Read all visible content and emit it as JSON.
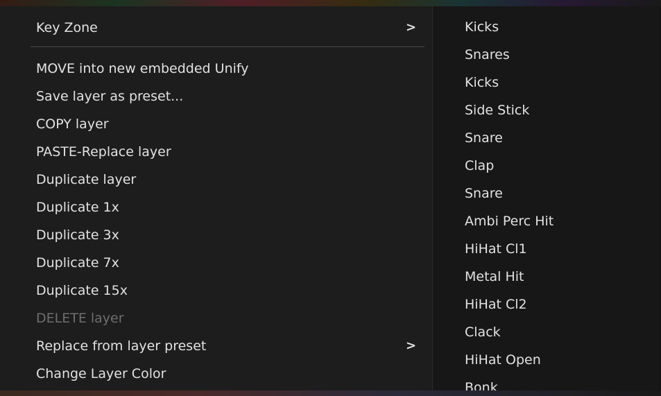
{
  "main_menu": {
    "items": [
      {
        "label": "Key Zone",
        "submenu_arrow": ">"
      },
      {
        "label": "MOVE into new embedded Unify"
      },
      {
        "label": "Save layer as preset..."
      },
      {
        "label": "COPY layer"
      },
      {
        "label": "PASTE-Replace layer"
      },
      {
        "label": "Duplicate layer"
      },
      {
        "label": "Duplicate 1x"
      },
      {
        "label": "Duplicate 3x"
      },
      {
        "label": "Duplicate 7x"
      },
      {
        "label": "Duplicate 15x"
      },
      {
        "label": "DELETE layer",
        "disabled": true
      },
      {
        "label": "Replace from layer preset",
        "submenu_arrow": ">"
      },
      {
        "label": "Change Layer Color"
      }
    ]
  },
  "sub_menu": {
    "items": [
      {
        "label": "Kicks"
      },
      {
        "label": "Snares"
      },
      {
        "label": "Kicks"
      },
      {
        "label": "Side Stick"
      },
      {
        "label": "Snare"
      },
      {
        "label": "Clap"
      },
      {
        "label": "Snare"
      },
      {
        "label": "Ambi Perc Hit"
      },
      {
        "label": "HiHat Cl1"
      },
      {
        "label": "Metal Hit"
      },
      {
        "label": "HiHat Cl2"
      },
      {
        "label": "Clack"
      },
      {
        "label": "HiHat Open"
      },
      {
        "label": "Bonk"
      }
    ]
  },
  "colors": {
    "menu_background": "#1d1d1d",
    "submenu_background": "#171717",
    "text": "#e2e2e2",
    "disabled_text": "#6e6e6e",
    "separator": "#4a4a4a"
  }
}
